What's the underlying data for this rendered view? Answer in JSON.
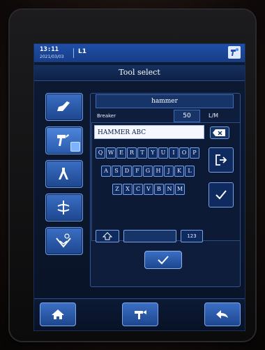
{
  "status": {
    "time": "13:11",
    "date": "2021/03/03",
    "level": "L1",
    "tool_icon": "hammer-tool-icon"
  },
  "title": "Tool select",
  "sidebar": {
    "items": [
      {
        "icon": "bucket-icon",
        "selected": false
      },
      {
        "icon": "hammer-icon",
        "selected": true
      },
      {
        "icon": "grapple-icon",
        "selected": false
      },
      {
        "icon": "tiltrotator-icon",
        "selected": false
      },
      {
        "icon": "add-tool-icon",
        "selected": false
      }
    ]
  },
  "tool": {
    "name": "hammer",
    "breaker_label": "Breaker",
    "value": "50",
    "unit": "L/M"
  },
  "keyboard": {
    "input_value": "HAMMER ABC",
    "rows": [
      [
        "Q",
        "W",
        "E",
        "R",
        "T",
        "Y",
        "U",
        "I",
        "O",
        "P"
      ],
      [
        "A",
        "S",
        "D",
        "F",
        "G",
        "H",
        "J",
        "K",
        "L"
      ],
      [
        "Z",
        "X",
        "C",
        "V",
        "B",
        "N",
        "M"
      ]
    ],
    "numeric_label": "123",
    "backspace_icon": "backspace-icon",
    "exit_icon": "exit-icon",
    "enter_icon": "checkmark-icon"
  },
  "footer": {
    "home_icon": "home-icon",
    "tool_icon": "hammer-toggle-icon",
    "back_icon": "back-arrow-icon"
  },
  "colors": {
    "accent": "#3b6fc4",
    "statusbar": "#1f4fa8",
    "screen_bg": "#0d1a33"
  }
}
